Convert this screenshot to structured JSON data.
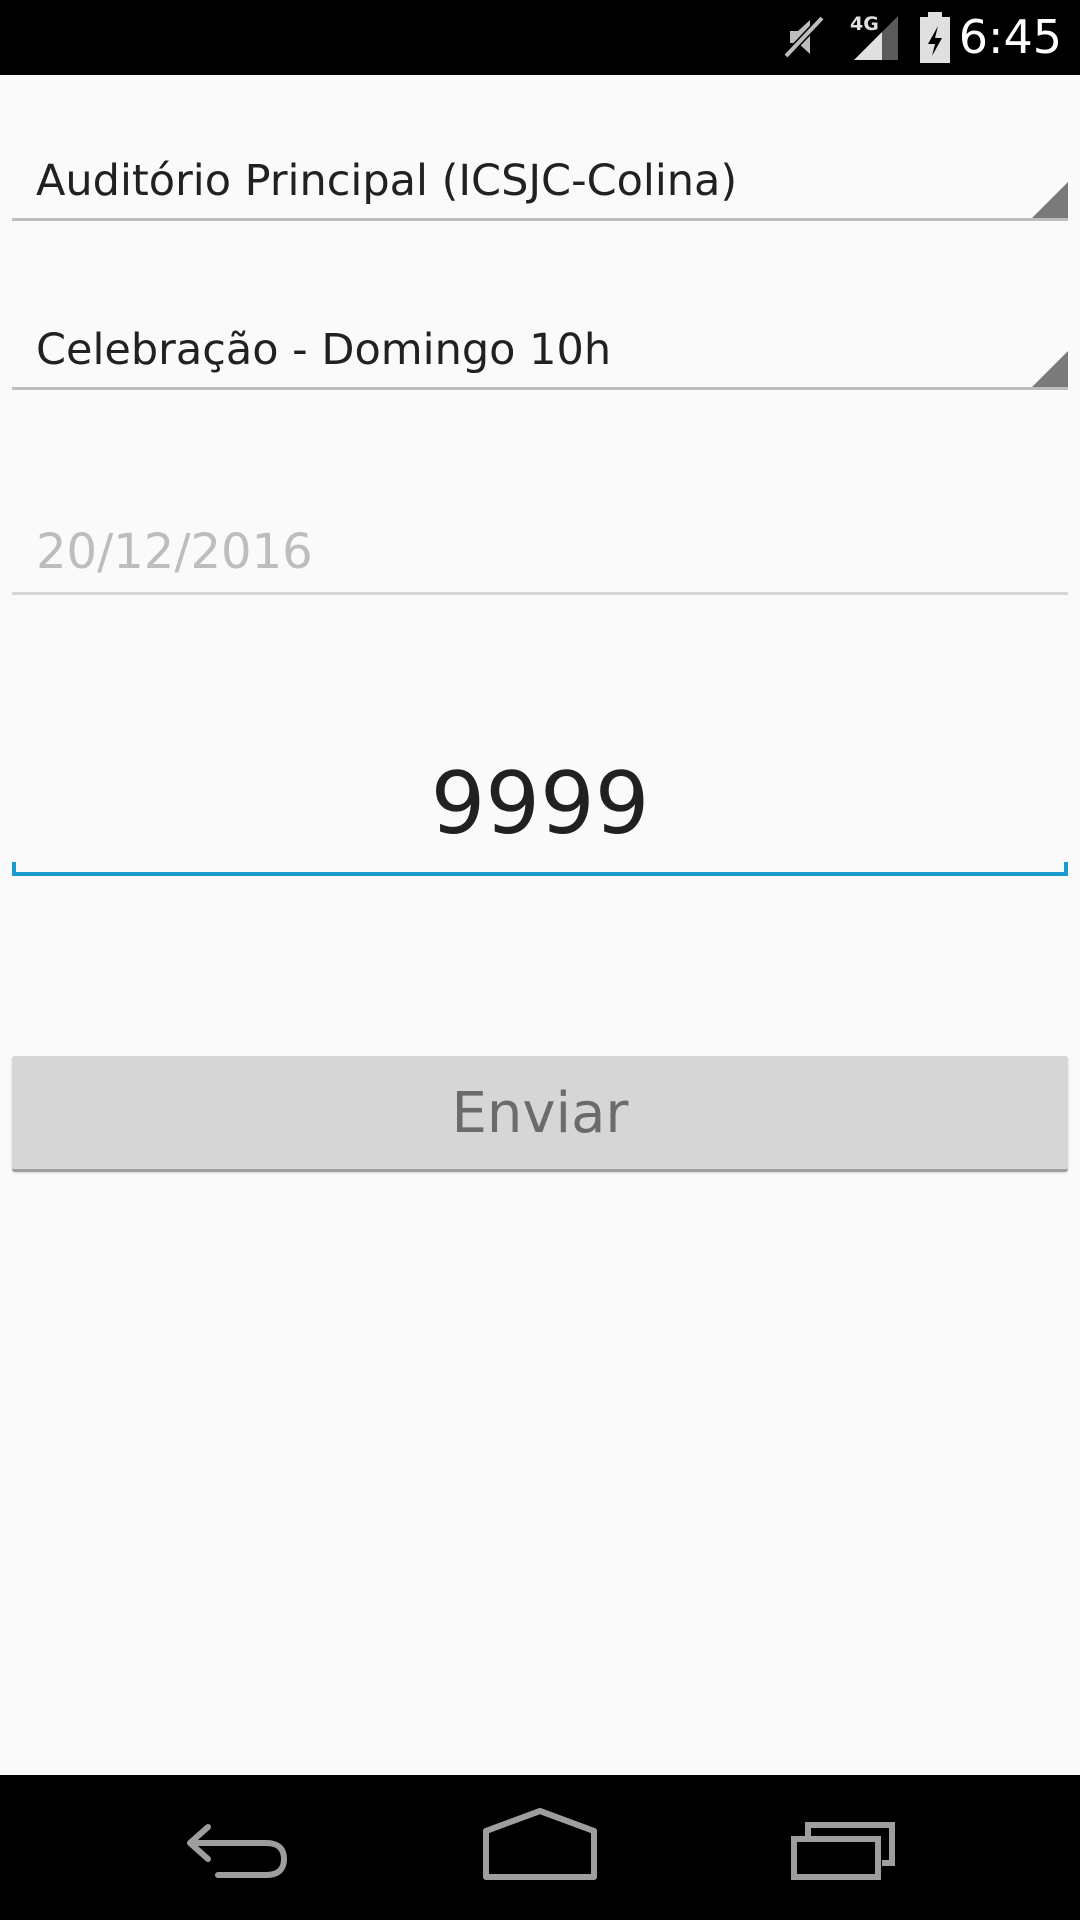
{
  "status_bar": {
    "time": "6:45",
    "network": "4G",
    "icons": [
      "mute-icon",
      "signal-icon",
      "battery-icon"
    ]
  },
  "form": {
    "auditorium_spinner": {
      "value": "Auditório Principal (ICSJC-Colina)"
    },
    "service_spinner": {
      "value": "Celebração - Domingo 10h"
    },
    "date_field": {
      "value": "20/12/2016"
    },
    "number_field": {
      "value": "9999"
    },
    "send_button": {
      "label": "Enviar"
    }
  },
  "nav_bar": {
    "icons": [
      "back-icon",
      "home-icon",
      "recents-icon"
    ]
  },
  "colors": {
    "accent": "#1a9ad1",
    "background": "#fafafa",
    "button": "#d6d6d6"
  }
}
